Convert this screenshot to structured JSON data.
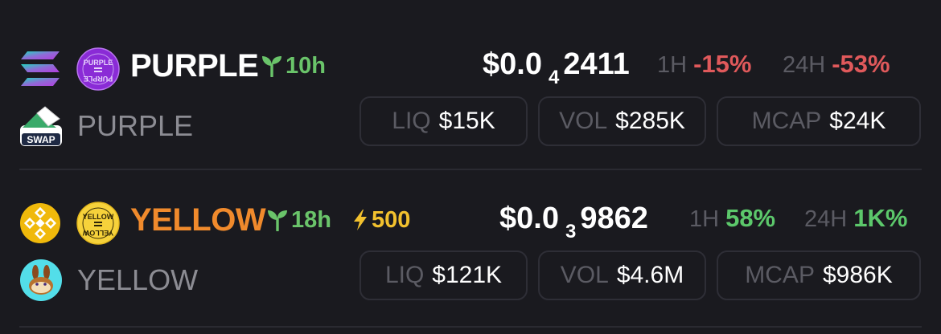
{
  "colors": {
    "background": "#1a1a1f",
    "negative": "#e0595b",
    "positive": "#5cc86b",
    "age_green": "#6ac46a",
    "boost_yellow": "#f2c12e",
    "purple_name": "#ffffff",
    "yellow_name": "#f08a2c"
  },
  "tokens": [
    {
      "name": "PURPLE",
      "symbol": "PURPLE",
      "chain_icon": "solana-icon",
      "token_icon": "purple-token-icon",
      "dex_icon": "swap-dex-icon",
      "dex_label": "SWAP",
      "token_icon_text": "PURPLE",
      "age": "10h",
      "price_prefix": "$0.0",
      "price_zeros": "4",
      "price_digits": "2411",
      "h1_label": "1H",
      "h1_change": "-15%",
      "h24_label": "24H",
      "h24_change": "-53%",
      "liq_label": "LIQ",
      "liq_value": "$15K",
      "vol_label": "VOL",
      "vol_value": "$285K",
      "mcap_label": "MCAP",
      "mcap_value": "$24K"
    },
    {
      "name": "YELLOW",
      "symbol": "YELLOW",
      "chain_icon": "bnb-icon",
      "token_icon": "yellow-token-icon",
      "dex_icon": "pancakeswap-icon",
      "token_icon_text": "YELLOW",
      "age": "18h",
      "boost": "500",
      "price_prefix": "$0.0",
      "price_zeros": "3",
      "price_digits": "9862",
      "h1_label": "1H",
      "h1_change": "58%",
      "h24_label": "24H",
      "h24_change": "1K%",
      "liq_label": "LIQ",
      "liq_value": "$121K",
      "vol_label": "VOL",
      "vol_value": "$4.6M",
      "mcap_label": "MCAP",
      "mcap_value": "$986K"
    }
  ]
}
